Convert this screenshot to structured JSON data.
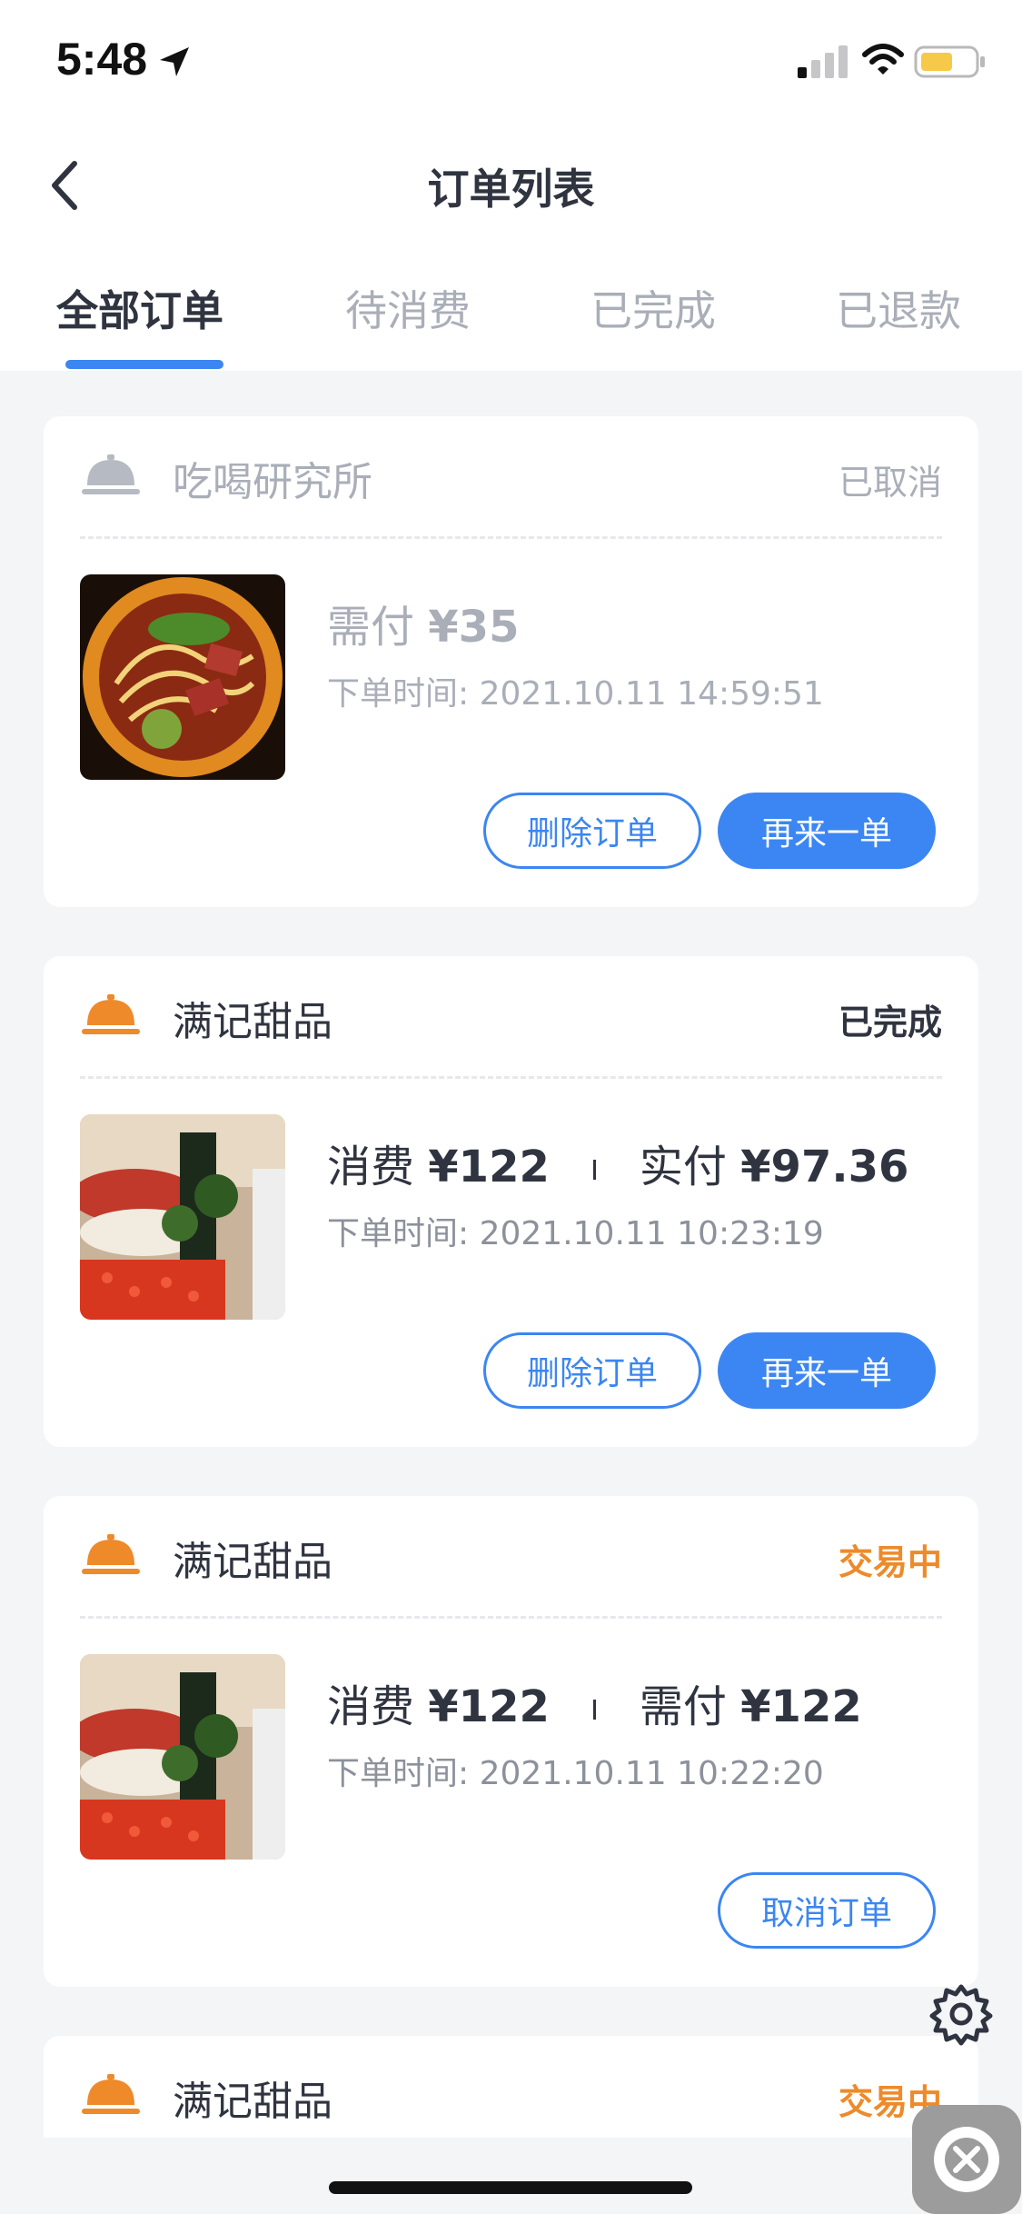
{
  "status_bar": {
    "time": "5:48",
    "icons": [
      "location-arrow-icon",
      "signal-icon",
      "wifi-icon",
      "battery-icon"
    ]
  },
  "header": {
    "title": "订单列表",
    "back_icon": "chevron-left-icon"
  },
  "tabs": [
    {
      "label": "全部订单",
      "active": true
    },
    {
      "label": "待消费",
      "active": false
    },
    {
      "label": "已完成",
      "active": false
    },
    {
      "label": "已退款",
      "active": false
    }
  ],
  "orders": [
    {
      "shop_name": "吃喝研究所",
      "status": "已取消",
      "price_label": "需付",
      "price_amount": "¥35",
      "order_time": "下单时间: 2021.10.11 14:59:51",
      "buttons": [
        "删除订单",
        "再来一单"
      ]
    },
    {
      "shop_name": "满记甜品",
      "status": "已完成",
      "spend_label": "消费",
      "spend_amount": "¥122",
      "price_label": "实付",
      "price_amount": "¥97.36",
      "order_time": "下单时间: 2021.10.11 10:23:19",
      "buttons": [
        "删除订单",
        "再来一单"
      ]
    },
    {
      "shop_name": "满记甜品",
      "status": "交易中",
      "spend_label": "消费",
      "spend_amount": "¥122",
      "price_label": "需付",
      "price_amount": "¥122",
      "order_time": "下单时间: 2021.10.11 10:22:20",
      "buttons": [
        "取消订单"
      ]
    },
    {
      "shop_name": "满记甜品",
      "status": "交易中"
    }
  ],
  "colors": {
    "accent": "#3b86f2",
    "orange": "#ee8a2a",
    "text": "#2f3440",
    "muted": "#a9aeb8"
  }
}
